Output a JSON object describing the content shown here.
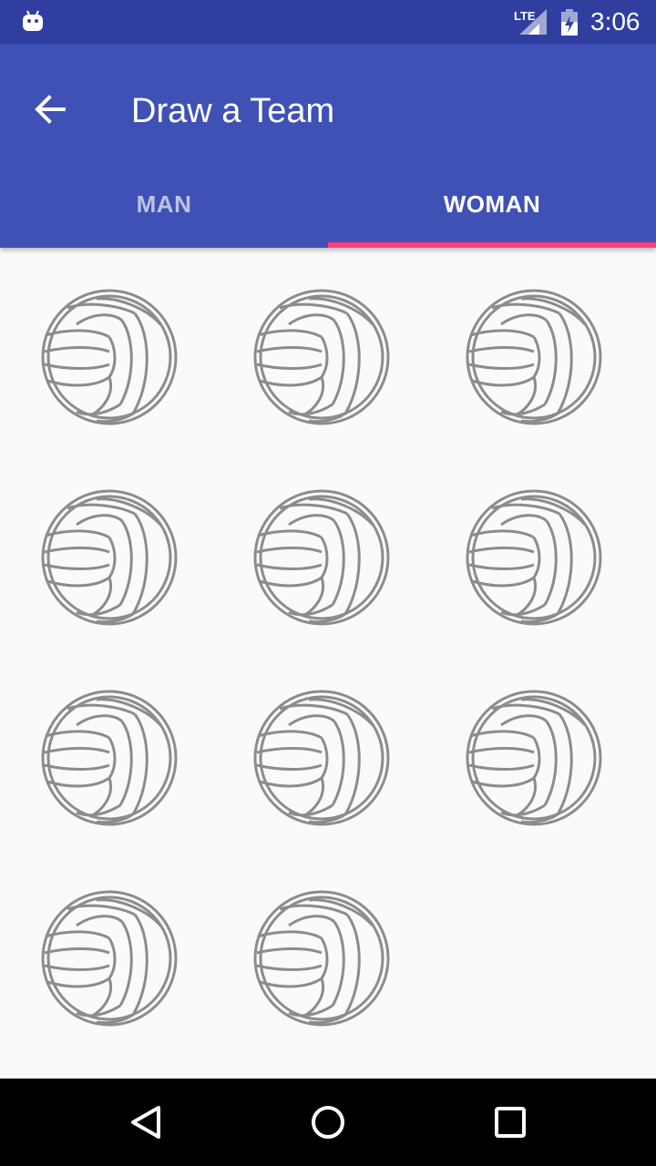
{
  "status_bar": {
    "time": "3:06",
    "network_label": "LTE",
    "icons": [
      "android-debug-icon",
      "lte-signal-icon",
      "battery-charging-icon"
    ]
  },
  "app_bar": {
    "title": "Draw a Team",
    "back_icon": "arrow-back-icon",
    "colors": {
      "primary": "#3f51b5",
      "primary_dark": "#303f9f",
      "accent": "#ff4081"
    }
  },
  "tabs": [
    {
      "label": "MAN",
      "selected": false
    },
    {
      "label": "WOMAN",
      "selected": true
    }
  ],
  "grid": {
    "item_icon": "volleyball-icon",
    "item_count": 11,
    "columns": 3
  },
  "nav_bar": {
    "icons": [
      "back-triangle-icon",
      "home-circle-icon",
      "recents-square-icon"
    ]
  }
}
